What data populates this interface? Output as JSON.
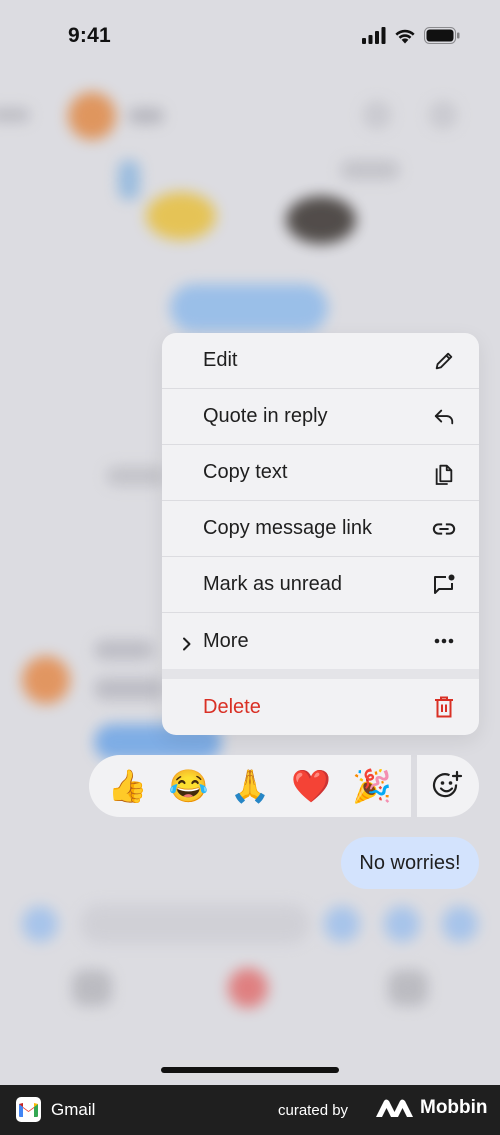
{
  "status_bar": {
    "time": "9:41"
  },
  "menu": {
    "items": [
      {
        "label": "Edit",
        "icon": "pencil-icon"
      },
      {
        "label": "Quote in reply",
        "icon": "reply-icon"
      },
      {
        "label": "Copy text",
        "icon": "copy-icon"
      },
      {
        "label": "Copy message link",
        "icon": "link-icon"
      },
      {
        "label": "Mark as unread",
        "icon": "mark-unread-icon"
      },
      {
        "label": "More",
        "icon": "more-dots-icon"
      }
    ],
    "delete_label": "Delete",
    "delete_color": "#d93025"
  },
  "reactions": {
    "emojis": [
      "👍",
      "😂",
      "🙏",
      "❤️",
      "🎉"
    ],
    "add_icon": "add-emoji-icon"
  },
  "message": {
    "text": "No worries!",
    "bubble_color": "#d3e3fd"
  },
  "footer": {
    "app_name": "Gmail",
    "curated_by": "curated by",
    "brand": "Mobbin"
  }
}
